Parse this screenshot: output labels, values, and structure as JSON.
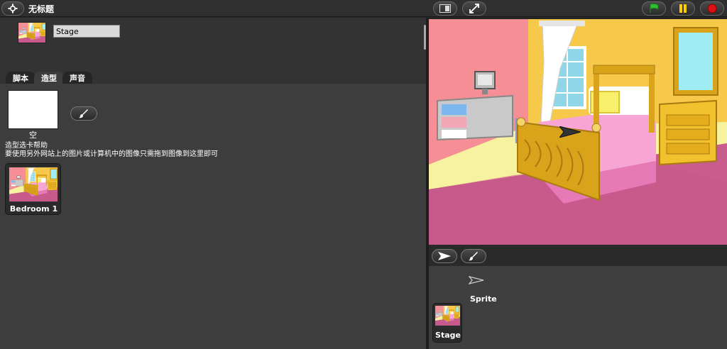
{
  "header": {
    "title": "无标题",
    "icons": {
      "menu": "gear-icon",
      "small_stage": "small-stage-icon",
      "fullscreen": "fullscreen-icon",
      "green_flag": "green-flag-icon",
      "pause": "pause-icon",
      "stop": "stop-icon"
    },
    "colors": {
      "flag": "#2fbf2f",
      "pause": "#ffcc00",
      "stop": "#dd1111"
    }
  },
  "sprite_info": {
    "name": "Stage"
  },
  "tabs": [
    {
      "label": "脚本",
      "active": false
    },
    {
      "label": "造型",
      "active": true
    },
    {
      "label": "声音",
      "active": false
    }
  ],
  "costumes": {
    "blank_label": "空",
    "help_title": "造型选卡帮助",
    "help_text": "要使用另外网站上的图片或计算机中的图像只需拖到图像到这里即可",
    "items": [
      {
        "name": "Bedroom 1"
      }
    ]
  },
  "sprites": {
    "new_sprite_label": "Sprite",
    "stage_label": "Stage"
  }
}
